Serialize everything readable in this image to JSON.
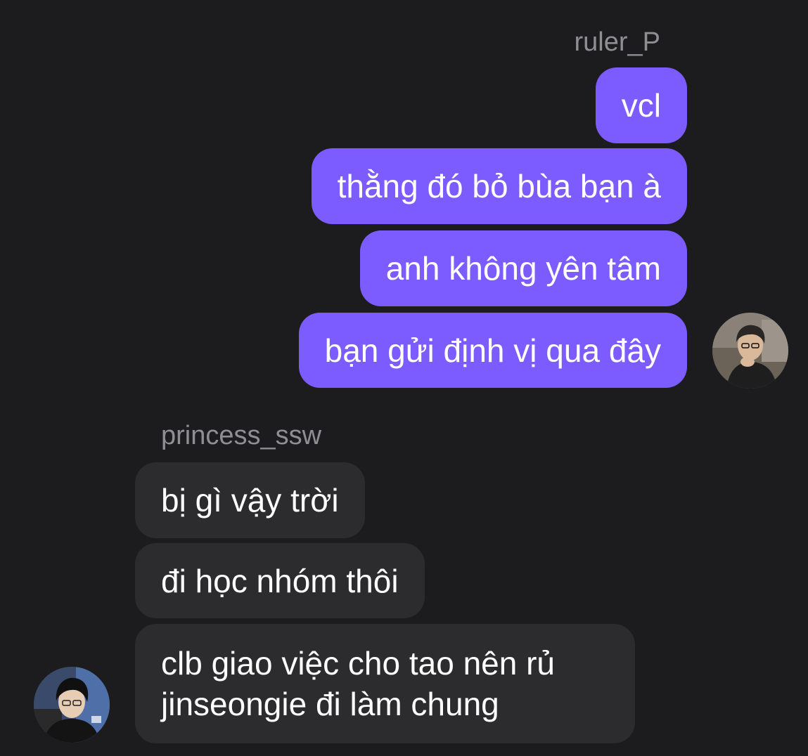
{
  "conversation": {
    "outgoing": {
      "username": "ruler_P",
      "messages": [
        "vcl",
        "thằng đó bỏ bùa bạn à",
        "anh không yên tâm",
        "bạn gửi định vị qua đây"
      ]
    },
    "incoming": {
      "username": "princess_ssw",
      "messages": [
        "bị gì vậy trời",
        "đi học nhóm thôi",
        "clb giao việc cho tao nên rủ jinseongie đi làm chung"
      ]
    }
  },
  "colors": {
    "background": "#1c1c1e",
    "outgoing_bubble": "#7c5cff",
    "incoming_bubble": "#2c2c2e",
    "username_text": "#8e8e93",
    "message_text": "#ffffff"
  }
}
